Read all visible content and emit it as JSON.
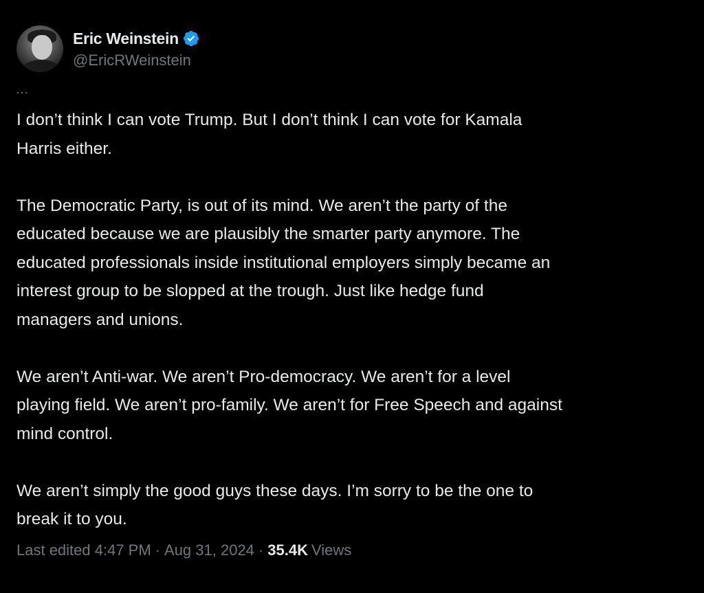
{
  "author": {
    "display_name": "Eric Weinstein",
    "handle": "@EricRWeinstein",
    "verified_icon": "verified-badge-icon",
    "avatar_icon": "avatar"
  },
  "more_icon": "…",
  "tweet": {
    "paragraphs": [
      "I don’t think I can vote Trump. But I don’t think I can vote for Kamala\nHarris either.",
      "The Democratic Party, is out of its mind. We aren’t the party of the\neducated because we are plausibly the smarter party anymore. The\neducated professionals inside institutional employers simply became an\ninterest group to be slopped at the trough. Just like hedge fund\nmanagers and unions.",
      "We aren’t Anti-war. We aren’t Pro-democracy. We aren’t for a level\nplaying field. We aren’t pro-family. We aren’t for Free Speech and against\nmind control.",
      "We aren’t simply the good guys these days. I’m sorry to be the one to\nbreak it to you."
    ]
  },
  "meta": {
    "edited_label": "Last edited 4:47 PM",
    "separator": "·",
    "date": "Aug 31, 2024",
    "views_count": "35.4K",
    "views_label": "Views"
  },
  "colors": {
    "background": "#000000",
    "text": "#e7e9ea",
    "secondary": "#71767b",
    "verified": "#1d9bf0"
  }
}
